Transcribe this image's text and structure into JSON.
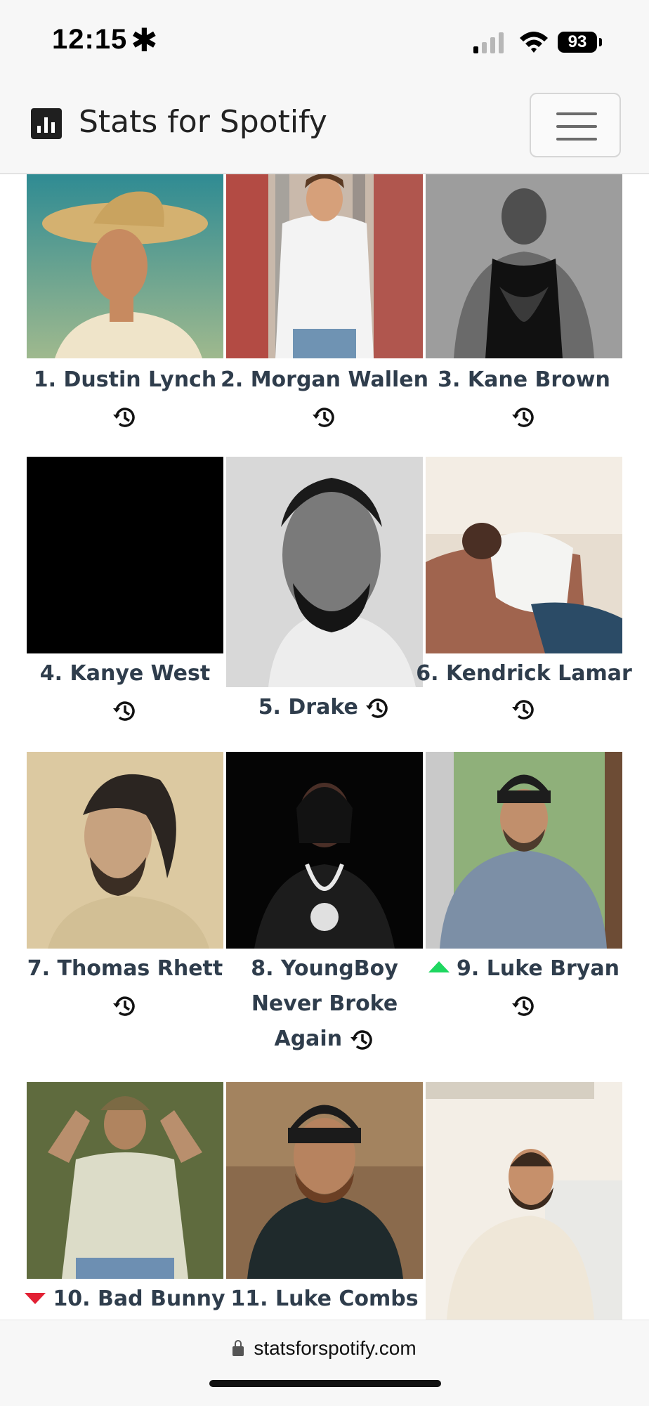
{
  "status": {
    "time": "12:15",
    "battery": "93"
  },
  "navbar": {
    "brand": "Stats for Spotify"
  },
  "artists": [
    {
      "label": "1. Dustin Lynch",
      "trend": "none"
    },
    {
      "label": "2. Morgan Wallen",
      "trend": "none"
    },
    {
      "label": "3. Kane Brown",
      "trend": "none"
    },
    {
      "label": "4. Kanye West",
      "trend": "none"
    },
    {
      "label": "5. Drake",
      "trend": "none"
    },
    {
      "label": "6. Kendrick Lamar",
      "trend": "none"
    },
    {
      "label": "7. Thomas Rhett",
      "trend": "none"
    },
    {
      "label": "8. YoungBoy Never Broke Again",
      "trend": "none"
    },
    {
      "label": "9. Luke Bryan",
      "trend": "up"
    },
    {
      "label": "10. Bad Bunny",
      "trend": "down"
    },
    {
      "label": "11. Luke Combs",
      "trend": "none"
    },
    {
      "label": "",
      "trend": "none"
    }
  ],
  "url_bar": {
    "domain": "statsforspotify.com"
  },
  "colors": {
    "text": "#2f3d4c",
    "up": "#1ed760",
    "down": "#e22134"
  }
}
